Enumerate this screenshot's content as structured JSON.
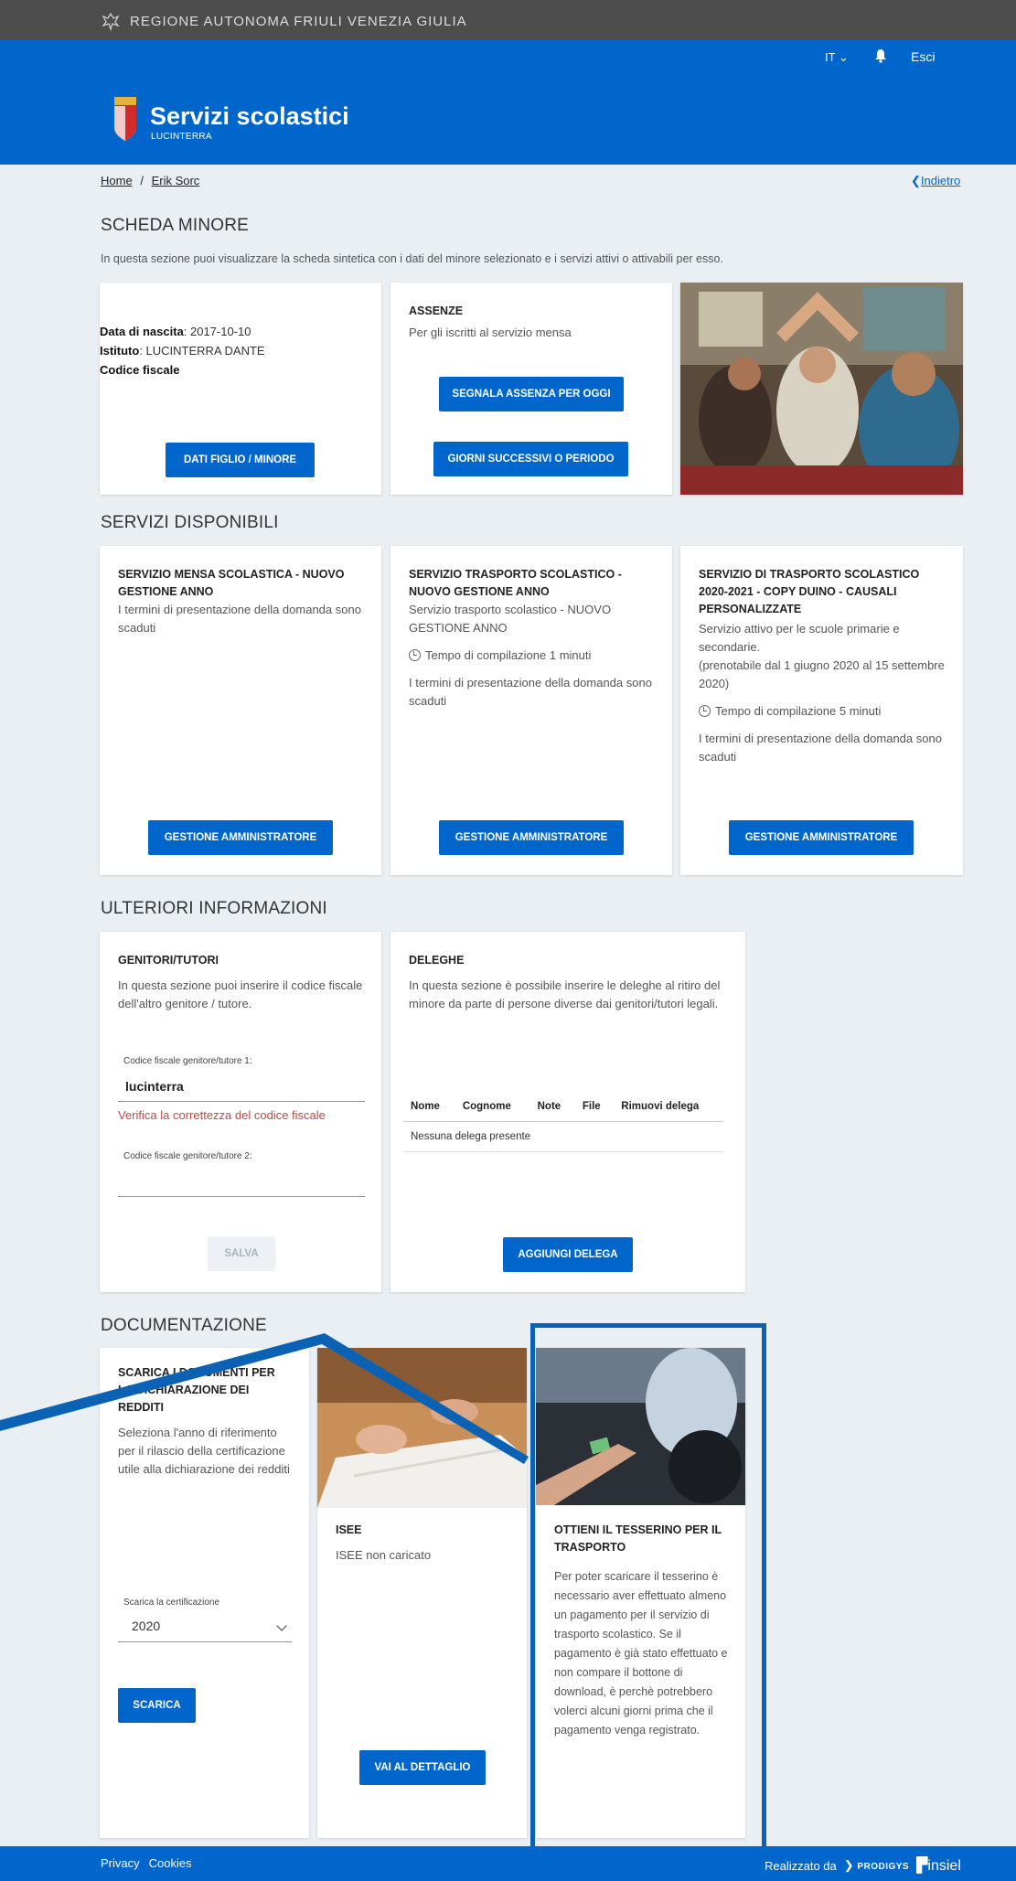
{
  "topbar": {
    "region": "REGIONE AUTONOMA FRIULI VENEZIA GIULIA"
  },
  "navbar": {
    "lang": "IT ⌄",
    "exit": "Esci"
  },
  "header": {
    "title": "Servizi scolastici",
    "subtitle": "LUCINTERRA"
  },
  "breadcrumb": {
    "home": "Home",
    "sep": "/",
    "current": "Erik Sorc",
    "back": "Indietro"
  },
  "scheda": {
    "title": "SCHEDA MINORE",
    "desc": "In questa sezione puoi visualizzare la scheda sintetica con i dati del minore selezionato e i servizi attivi o attivabili per esso.",
    "birth_label": "Data di nascita",
    "birth_value": ": 2017-10-10",
    "institute_label": "Istituto",
    "institute_value": ": LUCINTERRA DANTE",
    "cf_label": "Codice fiscale",
    "dati_button": "DATI FIGLIO / MINORE",
    "assenze_title": "ASSENZE",
    "assenze_desc": "Per gli iscritti al servizio mensa",
    "segnala_button": "SEGNALA ASSENZA PER OGGI",
    "giorni_button": "GIORNI SUCCESSIVI O PERIODO"
  },
  "servizi": {
    "title": "SERVIZI DISPONIBILI",
    "cards": [
      {
        "title": "SERVIZIO MENSA SCOLASTICA - NUOVO GESTIONE ANNO",
        "desc": "I termini di presentazione della domanda sono scaduti",
        "button": "GESTIONE AMMINISTRATORE"
      },
      {
        "title": "SERVIZIO TRASPORTO SCOLASTICO - NUOVO GESTIONE ANNO",
        "desc": "Servizio trasporto scolastico - NUOVO GESTIONE ANNO",
        "time": "Tempo di compilazione 1 minuti",
        "expired": "I termini di presentazione della domanda sono scaduti",
        "button": "GESTIONE AMMINISTRATORE"
      },
      {
        "title": "SERVIZIO DI TRASPORTO SCOLASTICO 2020-2021 - COPY DUINO - CAUSALI PERSONALIZZATE",
        "desc": "Servizio attivo per le scuole primarie e secondarie.",
        "desc2": "(prenotabile dal 1 giugno 2020 al 15 settembre 2020)",
        "time": "Tempo di compilazione 5 minuti",
        "expired": "I termini di presentazione della domanda sono scaduti",
        "button": "GESTIONE AMMINISTRATORE"
      }
    ]
  },
  "ulteriori": {
    "title": "ULTERIORI INFORMAZIONI",
    "genitori": {
      "title": "GENITORI/TUTORI",
      "desc": "In questa sezione puoi inserire il codice fiscale dell'altro genitore / tutore.",
      "field1_label": "Codice fiscale genitore/tutore 1:",
      "field1_value": "lucinterra",
      "error": "Verifica la correttezza del codice fiscale",
      "field2_label": "Codice fiscale genitore/tutore 2:",
      "save": "SALVA"
    },
    "deleghe": {
      "title": "DELEGHE",
      "desc": "In questa sezione è possibile inserire le deleghe al ritiro del minore da parte di persone diverse dai genitori/tutori legali.",
      "columns": [
        "Nome",
        "Cognome",
        "Note",
        "File",
        "Rimuovi delega"
      ],
      "empty": "Nessuna delega presente",
      "button": "AGGIUNGI DELEGA"
    }
  },
  "documentazione": {
    "title": "DOCUMENTAZIONE",
    "redditi": {
      "title": "SCARICA I DOCUMENTI PER LA DICHIARAZIONE DEI REDDITI",
      "desc": "Seleziona l'anno di riferimento per il rilascio della certificazione utile alla dichiarazione dei redditi",
      "select_label": "Scarica la certificazione",
      "select_value": "2020",
      "button": "SCARICA"
    },
    "isee": {
      "title": "ISEE",
      "desc": "ISEE non caricato",
      "button": "VAI AL DETTAGLIO"
    },
    "tesserino": {
      "title": "OTTIENI IL TESSERINO PER IL TRASPORTO",
      "desc": "Per poter scaricare il tesserino è necessario aver effettuato almeno un pagamento per il servizio di trasporto scolastico. Se il pagamento è già stato effettuato e non compare il bottone di download, è perchè potrebbero volerci alcuni giorni prima che il pagamento venga registrato."
    }
  },
  "footer": {
    "privacy": "Privacy",
    "cookies": "Cookies",
    "made_by": "Realizzato da",
    "brand1": "PRODIGYS",
    "brand2": "insiel"
  },
  "colors": {
    "primary": "#0066cc",
    "topbar": "#4d4d4d",
    "background": "#eaeff3",
    "error": "#b94a48",
    "highlight": "#0b62b5"
  }
}
